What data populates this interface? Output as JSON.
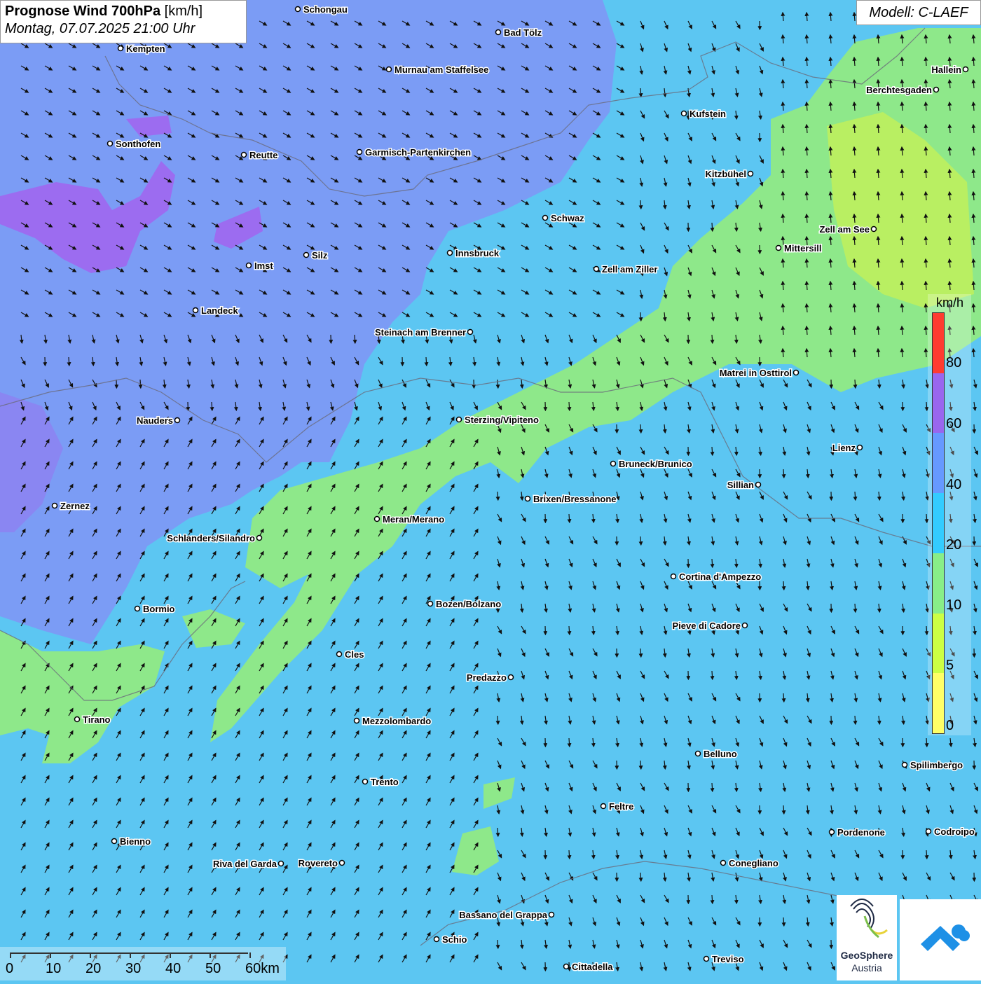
{
  "header": {
    "title_bold": "Prognose Wind 700hPa",
    "title_unit": "[km/h]",
    "datetime": "Montag, 07.07.2025 21:00 Uhr"
  },
  "model": "Modell: C-LAEF",
  "legend": {
    "unit": "km/h",
    "colors": [
      "#ff3b30",
      "#9966ee",
      "#6699ff",
      "#33ccff",
      "#88ee88",
      "#ccff44",
      "#ffff66"
    ],
    "labels": [
      "80",
      "60",
      "40",
      "20",
      "10",
      "5",
      "0"
    ]
  },
  "scalebar": {
    "labels": [
      "0",
      "10",
      "20",
      "30",
      "40",
      "50",
      "60km"
    ]
  },
  "logos": {
    "geosphere_name": "GeoSphere",
    "geosphere_sub": "Austria",
    "geosphere_icon": "geosphere-swirl-icon",
    "app_icon": "cloud-arrow-icon"
  },
  "cities": [
    "Schongau",
    "Bad Tölz",
    "Kempten",
    "Murnau am Staffelsee",
    "Kufstein",
    "Hallein",
    "Berchtesgaden",
    "Sonthofen",
    "Reutte",
    "Garmisch-Partenkirchen",
    "Kitzbühel",
    "Schwaz",
    "Zell am See",
    "Mittersill",
    "Imst",
    "Silz",
    "Innsbruck",
    "Zell am Ziller",
    "Landeck",
    "Steinach am Brenner",
    "Matrei in Osttirol",
    "Nauders",
    "Sterzing/Vipiteno",
    "Lienz",
    "Bruneck/Brunico",
    "Sillian",
    "Zernez",
    "Brixen/Bressanone",
    "Meran/Merano",
    "Schlanders/Silandro",
    "Cortina d'Ampezzo",
    "Bozen/Bolzano",
    "Bormio",
    "Pieve di Cadore",
    "Cles",
    "Predazzo",
    "Tirano",
    "Mezzolombardo",
    "Belluno",
    "Spilimbergo",
    "Trento",
    "Feltre",
    "Pordenone",
    "Codroipo",
    "Bienno",
    "Riva del Garda",
    "Rovereto",
    "Conegliano",
    "Bassano del Grappa",
    "Schio",
    "Treviso",
    "Cittadella"
  ]
}
